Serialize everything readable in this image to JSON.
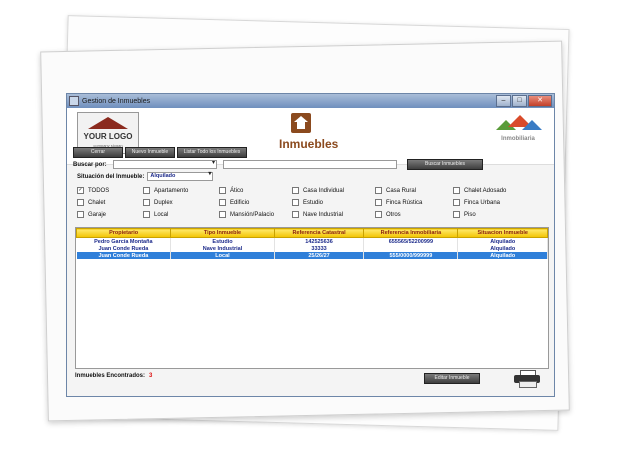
{
  "window": {
    "title": "Gestion de Inmuebles"
  },
  "header": {
    "logo_text": "YOUR LOGO",
    "logo_sub": "company slogan",
    "app_title": "Inmuebles",
    "brand_text": "Inmobiliaria"
  },
  "toolbar": {
    "close_label": "Cerrar",
    "new_label": "Nuevo Inmueble",
    "list_all_label": "Listar Todo los Inmuebles"
  },
  "search": {
    "label": "Buscar por:",
    "button_label": "Buscar Inmuebles",
    "status_label": "Situación del Inmueble:",
    "status_value": "Alquilado"
  },
  "types": [
    {
      "label": "TODOS",
      "checked": true
    },
    {
      "label": "Apartamento",
      "checked": false
    },
    {
      "label": "Ático",
      "checked": false
    },
    {
      "label": "Casa Individual",
      "checked": false
    },
    {
      "label": "Casa Rural",
      "checked": false
    },
    {
      "label": "Chalet Adosado",
      "checked": false
    },
    {
      "label": "Chalet",
      "checked": false
    },
    {
      "label": "Duplex",
      "checked": false
    },
    {
      "label": "Edificio",
      "checked": false
    },
    {
      "label": "Estudio",
      "checked": false
    },
    {
      "label": "Finca Rústica",
      "checked": false
    },
    {
      "label": "Finca Urbana",
      "checked": false
    },
    {
      "label": "Garaje",
      "checked": false
    },
    {
      "label": "Local",
      "checked": false
    },
    {
      "label": "Mansión/Palacio",
      "checked": false
    },
    {
      "label": "Nave Industrial",
      "checked": false
    },
    {
      "label": "Otros",
      "checked": false
    },
    {
      "label": "Piso",
      "checked": false
    }
  ],
  "table": {
    "columns": [
      "Propietario",
      "Tipo Inmueble",
      "Referencia Catastral",
      "Referencia Inmobiliaria",
      "Situacion Inmueble"
    ],
    "rows": [
      [
        "Pedro García Montaña",
        "Estudio",
        "142525636",
        "655565/52200999",
        "Alquilado"
      ],
      [
        "Juan Conde Rueda",
        "Nave Industrial",
        "33333",
        "",
        "Alquilado"
      ],
      [
        "Juan Conde Rueda",
        "Local",
        "25/26/27",
        "555/0000/999999",
        "Alquilado"
      ]
    ]
  },
  "footer": {
    "found_label": "Inmuebles Encontrados:",
    "found_count": "3",
    "edit_label": "Editar Inmueble"
  },
  "colors": {
    "header_yellow": "#f2c300",
    "selection_blue": "#2f7fd9",
    "brand_brown": "#8b4a1e"
  }
}
